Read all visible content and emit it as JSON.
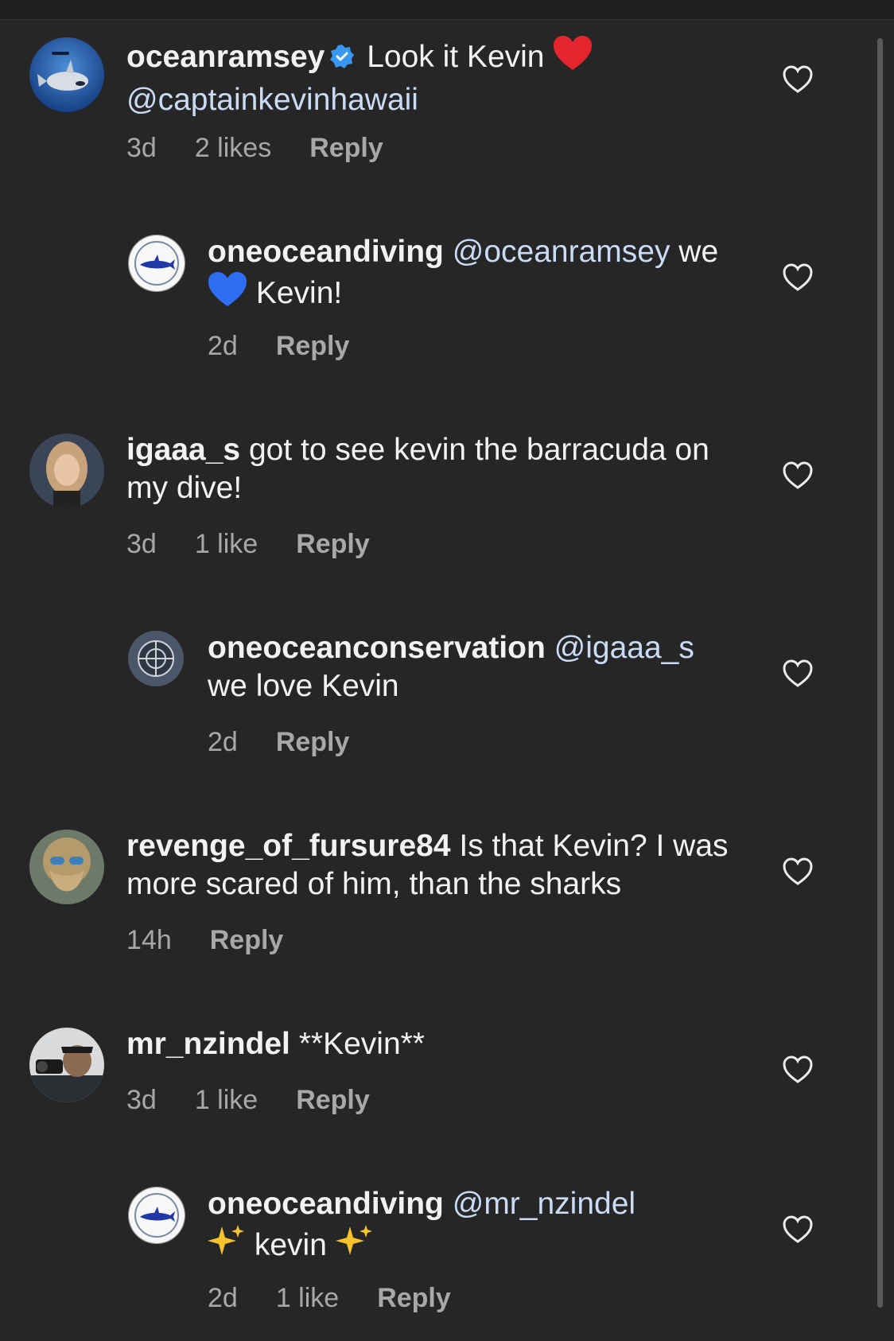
{
  "comments": [
    {
      "user": "oceanramsey",
      "verified": true,
      "text": "Look it Kevin",
      "emoji": "red-heart",
      "mention_after": "@captainkevinhawaii",
      "time": "3d",
      "likes": "2 likes",
      "reply": "Reply",
      "avatar": "shark-diver-avatar"
    },
    {
      "user": "oneoceandiving",
      "mention": "@oceanramsey",
      "text_a": "we",
      "emoji": "blue-heart",
      "text_b": "Kevin!",
      "time": "2d",
      "reply": "Reply",
      "avatar": "conservation-shark-logo"
    },
    {
      "user": "igaaa_s",
      "text": "got to see kevin the barracuda on my dive!",
      "time": "3d",
      "likes": "1 like",
      "reply": "Reply",
      "avatar": "woman-portrait-avatar"
    },
    {
      "user": "oneoceanconservation",
      "mention": "@igaaa_s",
      "text": "we love Kevin",
      "time": "2d",
      "reply": "Reply",
      "avatar": "conservation-compass-logo"
    },
    {
      "user": "revenge_of_fursure84",
      "text": "Is that Kevin? I was more scared of him, than the sharks",
      "time": "14h",
      "reply": "Reply",
      "avatar": "bearded-man-avatar"
    },
    {
      "user": "mr_nzindel",
      "text": "**Kevin**",
      "time": "3d",
      "likes": "1 like",
      "reply": "Reply",
      "avatar": "photographer-avatar"
    },
    {
      "user": "oneoceandiving",
      "mention": "@mr_nzindel",
      "text": "kevin",
      "emoji": "sparkles",
      "time": "2d",
      "likes": "1 like",
      "reply": "Reply",
      "avatar": "conservation-shark-logo"
    }
  ],
  "colors": {
    "background": "#262626",
    "text": "#f2f2f2",
    "mention": "#c9dbf5",
    "meta": "#a8a8a8",
    "verified": "#3897f0"
  }
}
